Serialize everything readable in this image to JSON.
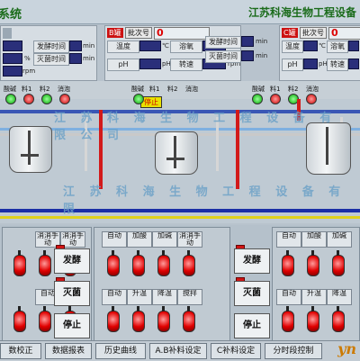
{
  "header": {
    "title_left": "系统",
    "company": "江苏科海生物工程设备"
  },
  "tanks": [
    {
      "tag": "",
      "batch_label": "批次号",
      "batch_no": "",
      "rows": [
        {
          "label": "",
          "value": "",
          "unit": "",
          "label2": "发酵时间",
          "value2": "",
          "unit2": "min"
        },
        {
          "label": "",
          "value": "",
          "unit": "%",
          "label2": "灭菌时间",
          "value2": "",
          "unit2": "min"
        },
        {
          "label": "",
          "value": "",
          "unit": "rpm",
          "label2": "",
          "value2": "",
          "unit2": ""
        }
      ]
    },
    {
      "tag": "B罐",
      "batch_label": "批次号",
      "batch_no": "0",
      "rows": [
        {
          "label": "温度",
          "value": "",
          "unit": "℃",
          "label2": "溶氧",
          "value2": "",
          "unit2": "%"
        },
        {
          "label": "pH",
          "value": "",
          "unit": "pH",
          "label2": "转速",
          "value2": "",
          "unit2": "rpm"
        }
      ],
      "extra_rows": [
        {
          "label": "发酵时间",
          "unit": "min"
        },
        {
          "label": "灭菌时间",
          "unit": "min"
        }
      ]
    },
    {
      "tag": "C罐",
      "batch_label": "批次号",
      "batch_no": "0",
      "rows": [
        {
          "label": "温度",
          "value": "",
          "unit": "℃",
          "label2": "溶氧",
          "value2": "",
          "unit2": "%"
        },
        {
          "label": "pH",
          "value": "",
          "unit": "pH",
          "label2": "转速",
          "value2": "",
          "unit2": "rpm"
        }
      ],
      "extra_rows": [
        {
          "label": "发酵时间",
          "unit": "min"
        },
        {
          "label": "灭菌时间",
          "unit": "min"
        }
      ]
    }
  ],
  "process": {
    "indicators": [
      "酸碱",
      "料1",
      "料2",
      "消泡",
      "酸碱",
      "料1",
      "料2",
      "消泡",
      "酸碱",
      "料1",
      "料2",
      "消泡"
    ],
    "stop_label": "停止",
    "watermark1": "江 苏 科 海 生 物 工 程 设 备 有 限 公 司",
    "watermark2": "江 苏 科 海 生 物 工 程 设 备 有 限"
  },
  "control_a": {
    "top_labels": [
      "",
      "",
      "消消手动",
      "消消手动"
    ],
    "bottom_labels": [
      "自动",
      "搅拌"
    ],
    "bottom_first_row": [
      "",
      ""
    ],
    "buttons": [
      "发酵",
      "灭菌",
      "停止"
    ]
  },
  "control_b": {
    "top_labels": [
      "自动",
      "加酸",
      "加碱",
      "消消手动",
      "自动",
      "加酸",
      "加碱",
      "消消手动"
    ],
    "bottom_labels": [
      "自动",
      "升温",
      "降温",
      "搅拌",
      "自动",
      "升温",
      "降温",
      "搅拌"
    ],
    "buttons": [
      "发酵",
      "灭菌",
      "停止"
    ]
  },
  "bottombar": {
    "buttons": [
      "数校正",
      "数据报表",
      "历史曲线",
      "A.B补料设定",
      "C补料设定",
      "分时段控制"
    ],
    "logo": "yn"
  }
}
